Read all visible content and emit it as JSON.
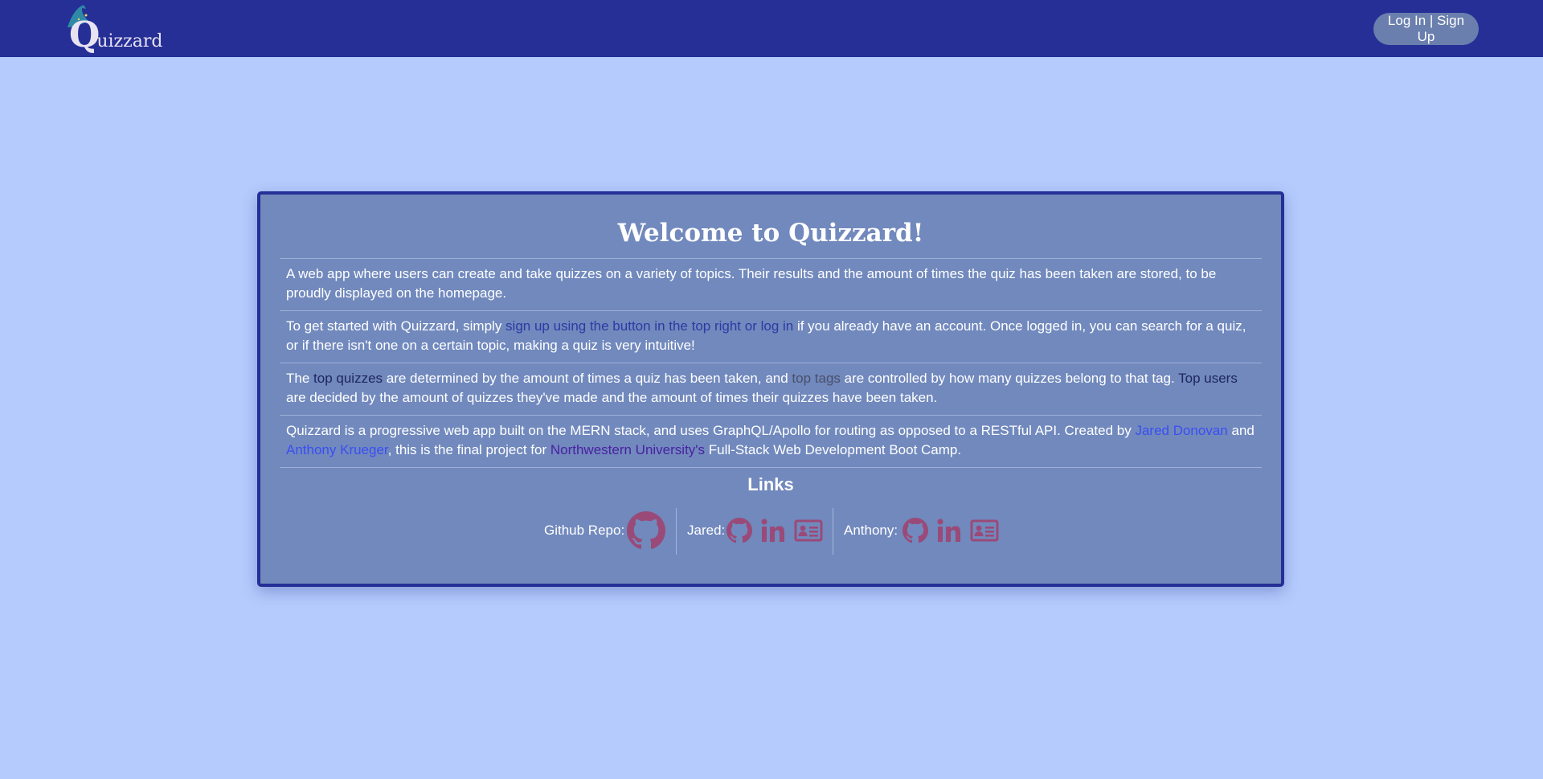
{
  "header": {
    "logo_text_initial": "Q",
    "logo_text_rest": "uizzard",
    "login_label": "Log In | Sign Up"
  },
  "welcome": {
    "title": "Welcome to Quizzard!",
    "p1": "A web app where users can create and take quizzes on a variety of topics. Their results and the amount of times the quiz has been taken are stored, to be proudly displayed on the homepage.",
    "p2_prefix": "To get started with Quizzard, simply ",
    "p2_link": "sign up using the button in the top right or log in",
    "p2_suffix": " if you already have an account. Once logged in, you can search for a quiz, or if there isn't one on a certain topic, making a quiz is very intuitive!",
    "p3_a": "The ",
    "p3_link1": "top quizzes",
    "p3_b": " are determined by the amount of times a quiz has been taken, and ",
    "p3_link2": "top tags",
    "p3_c": " are controlled by how many quizzes belong to that tag. ",
    "p3_link3": "Top users",
    "p3_d": " are decided by the amount of quizzes they've made and the amount of times their quizzes have been taken.",
    "p4_a": "Quizzard is a progressive web app built on the MERN stack, and uses GraphQL/Apollo for routing as opposed to a RESTful API. Created by ",
    "p4_link1": "Jared Donovan",
    "p4_b": " and ",
    "p4_link2": "Anthony Krueger",
    "p4_c": ", this is the final project for ",
    "p4_link3": "Northwestern University's",
    "p4_d": " Full-Stack Web Development Boot Camp."
  },
  "links": {
    "heading": "Links",
    "repo_label": "Github Repo:",
    "jared_label": "Jared:",
    "anthony_label": "Anthony:",
    "icons": [
      "github-icon",
      "linkedin-icon",
      "contact-card-icon"
    ]
  },
  "colors": {
    "navbar": "#252f96",
    "background": "#b5cbfd",
    "card": "#7189bd",
    "card_border": "#252f96",
    "icon": "#9a4a78",
    "login_button": "#6a7fad"
  }
}
